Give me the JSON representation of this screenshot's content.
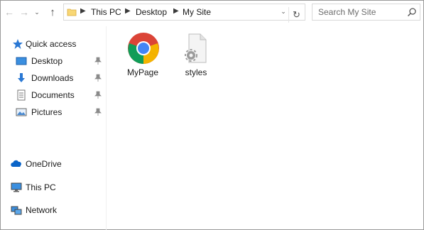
{
  "address_bar": {
    "breadcrumbs": [
      "This PC",
      "Desktop",
      "My Site"
    ]
  },
  "search": {
    "placeholder": "Search My Site"
  },
  "sidebar": {
    "quick_access": "Quick access",
    "items": [
      {
        "label": "Desktop",
        "icon": "desktop-icon",
        "pinned": true
      },
      {
        "label": "Downloads",
        "icon": "downloads-icon",
        "pinned": true
      },
      {
        "label": "Documents",
        "icon": "documents-icon",
        "pinned": true
      },
      {
        "label": "Pictures",
        "icon": "pictures-icon",
        "pinned": true
      }
    ],
    "onedrive": "OneDrive",
    "this_pc": "This PC",
    "network": "Network"
  },
  "files": [
    {
      "name": "MyPage",
      "icon": "chrome-html-file-icon"
    },
    {
      "name": "styles",
      "icon": "css-file-icon"
    }
  ],
  "colors": {
    "folder_yellow": "#f8d775",
    "chrome_red": "#db4437",
    "chrome_green": "#0f9d58",
    "chrome_yellow": "#f4b400",
    "chrome_blue": "#4285f4",
    "quick_access_blue": "#2a78d4",
    "onedrive_blue": "#0a64c8"
  }
}
